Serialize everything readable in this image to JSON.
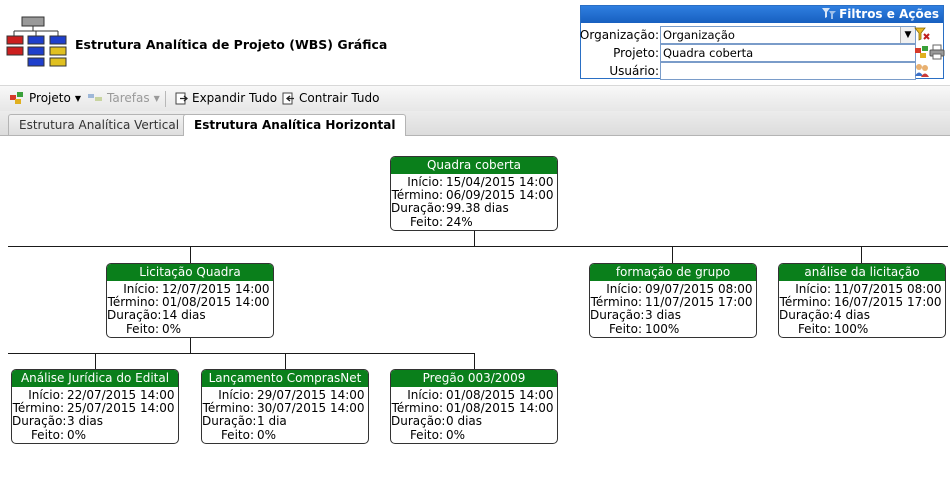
{
  "header": {
    "title": "Estrutura Analítica de Projeto (WBS) Gráfica"
  },
  "filters": {
    "title": "Filtros e Ações",
    "organizacao": {
      "label": "Organização:",
      "value": "Organização"
    },
    "projeto": {
      "label": "Projeto:",
      "value": "Quadra coberta"
    },
    "usuario": {
      "label": "Usuário:",
      "value": ""
    }
  },
  "toolbar": {
    "projeto": "Projeto",
    "tarefas": "Tarefas",
    "expandir": "Expandir Tudo",
    "contrair": "Contrair Tudo"
  },
  "tabs": [
    {
      "label": "Estrutura Analítica Vertical",
      "active": false
    },
    {
      "label": "Estrutura Analítica Horizontal",
      "active": true
    }
  ],
  "field_labels": {
    "inicio": "Início:",
    "termino": "Término:",
    "duracao": "Duração:",
    "feito": "Feito:"
  },
  "nodes": {
    "root": {
      "name": "Quadra coberta",
      "inicio": "15/04/2015 14:00",
      "termino": "06/09/2015 14:00",
      "duracao": "99.38 dias",
      "feito": "24%"
    },
    "licitacao": {
      "name": "Licitação Quadra",
      "inicio": "12/07/2015 14:00",
      "termino": "01/08/2015 14:00",
      "duracao": "14 dias",
      "feito": "0%"
    },
    "formacao": {
      "name": "formação de grupo",
      "inicio": "09/07/2015 08:00",
      "termino": "11/07/2015 17:00",
      "duracao": "3 dias",
      "feito": "100%"
    },
    "analise_lic": {
      "name": "análise da licitação",
      "inicio": "11/07/2015 08:00",
      "termino": "16/07/2015 17:00",
      "duracao": "4 dias",
      "feito": "100%"
    },
    "juridica": {
      "name": "Análise Jurídica do Edital",
      "inicio": "22/07/2015 14:00",
      "termino": "25/07/2015 14:00",
      "duracao": "3 dias",
      "feito": "0%"
    },
    "comprasnet": {
      "name": "Lançamento ComprasNet",
      "inicio": "29/07/2015 14:00",
      "termino": "30/07/2015 14:00",
      "duracao": "1 dia",
      "feito": "0%"
    },
    "pregao": {
      "name": "Pregão 003/2009",
      "inicio": "01/08/2015 14:00",
      "termino": "01/08/2015 14:00",
      "duracao": "0 dias",
      "feito": "0%"
    }
  }
}
